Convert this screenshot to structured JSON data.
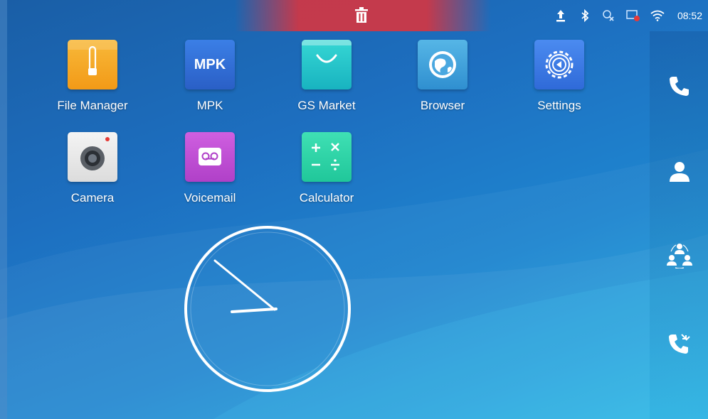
{
  "status_bar": {
    "time": "08:52",
    "icons": [
      "upload-icon",
      "bluetooth-icon",
      "missed-call-icon",
      "screen-record-icon",
      "wifi-icon"
    ],
    "trash_zone_color": "#cd3746"
  },
  "apps": [
    {
      "label": "File Manager",
      "icon": "file-manager-icon",
      "color": "#f5a623"
    },
    {
      "label": "MPK",
      "icon": "mpk-icon",
      "icon_text": "MPK",
      "color": "#2f6fd6"
    },
    {
      "label": "GS Market",
      "icon": "gs-market-icon",
      "color": "#1fc6c6"
    },
    {
      "label": "Browser",
      "icon": "browser-icon",
      "color": "#3aa0d8"
    },
    {
      "label": "Settings",
      "icon": "settings-icon",
      "color": "#3f7ee8"
    },
    {
      "label": "Camera",
      "icon": "camera-icon",
      "color": "#e8e8e8"
    },
    {
      "label": "Voicemail",
      "icon": "voicemail-icon",
      "color": "#c24fd6"
    },
    {
      "label": "Calculator",
      "icon": "calculator-icon",
      "color": "#2dd3a8"
    }
  ],
  "dock": [
    "phone-icon",
    "contacts-icon",
    "conference-icon",
    "call-history-icon"
  ],
  "clock": {
    "hour_hand": "08",
    "minute_hand": "52"
  }
}
